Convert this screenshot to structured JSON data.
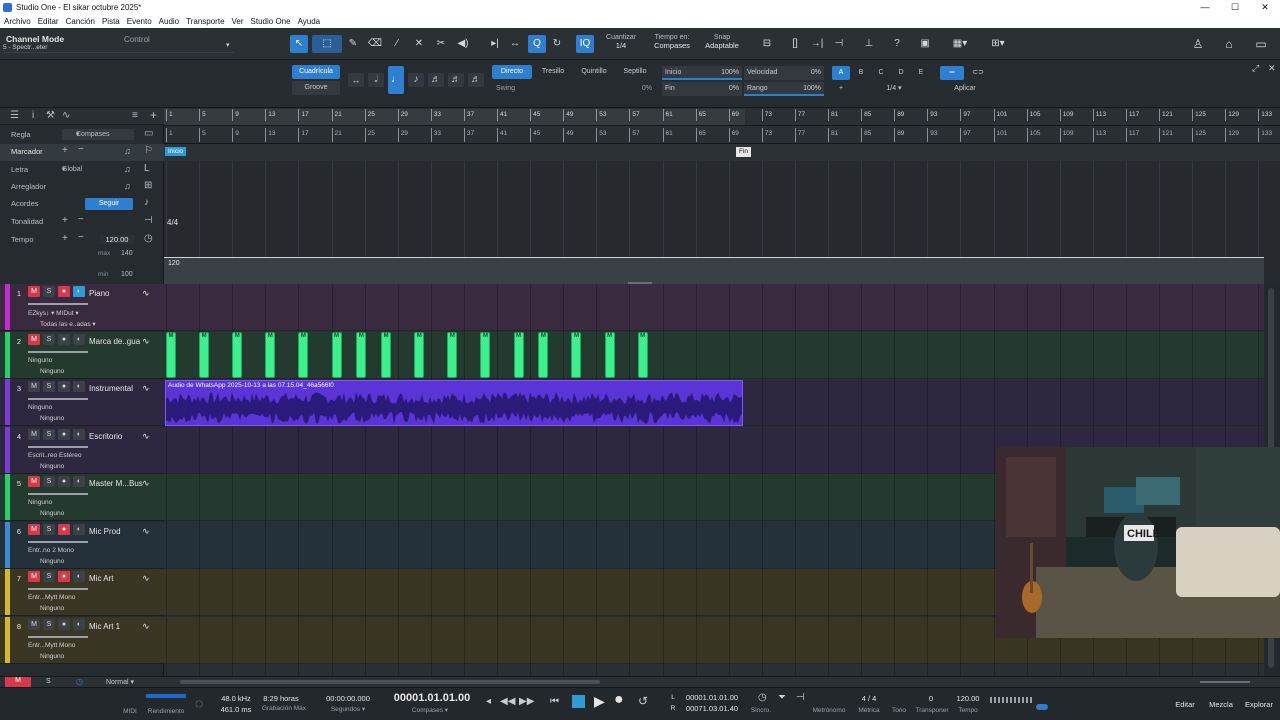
{
  "window": {
    "title": "Studio One - El sikar octubre 2025*",
    "controls": [
      "—",
      "☐",
      "✕"
    ]
  },
  "menu": [
    "Archivo",
    "Editar",
    "Canción",
    "Pista",
    "Evento",
    "Audio",
    "Transporte",
    "Ver",
    "Studio One",
    "Ayuda"
  ],
  "toolbar": {
    "channel_mode": "Channel Mode",
    "channel_sub": "5 - Spectr...eter",
    "control_label": "Control",
    "cuantizar_label": "Cuantizar",
    "cuantizar_value": "1/4",
    "tiempo_label": "Tiempo en:",
    "tiempo_value": "Compases",
    "snap_label": "Snap",
    "snap_value": "Adaptable"
  },
  "quantize": {
    "cuadricula": "Cuadrícula",
    "groove": "Groove",
    "directo": "Directo",
    "tresillo": "Tresillo",
    "quintillo": "Quintillo",
    "septillo": "Septillo",
    "inicio_label": "Inicio",
    "inicio_value": "100%",
    "velocidad_label": "Velocidad",
    "velocidad_value": "0%",
    "swing_label": "Swing",
    "swing_value": "0%",
    "fin_label": "Fin",
    "fin_value": "0%",
    "rango_label": "Rango",
    "rango_value": "100%",
    "letters": [
      "A",
      "B",
      "C",
      "D",
      "E"
    ],
    "plus": "+",
    "fraction": "1/4",
    "aplicar": "Aplicar"
  },
  "global": {
    "regla_label": "Regla",
    "regla_value": "Compases",
    "marcador_label": "Marcador",
    "letra_label": "Letra",
    "letra_value": "Global",
    "arreglador_label": "Arreglador",
    "acordes_label": "Acordes",
    "seguir_label": "Seguir",
    "tonalidad_label": "Tonalidad",
    "tempo_label": "Tempo",
    "tempo_value": "120.00",
    "max_label": "max",
    "max_value": "140",
    "min_label": "min",
    "min_value": "100",
    "time_sig": "4/4",
    "tempo_track_value": "120",
    "inicio_marker": "Inicio",
    "fin_marker": "Fin"
  },
  "ruler_numbers": [
    "1",
    "5",
    "9",
    "13",
    "17",
    "21",
    "25",
    "29",
    "33",
    "37",
    "41",
    "45",
    "49",
    "53",
    "57",
    "61",
    "65",
    "69",
    "73",
    "77",
    "81",
    "85",
    "89",
    "93",
    "97",
    "101",
    "105",
    "109",
    "113",
    "117",
    "121",
    "125",
    "129",
    "133"
  ],
  "tracks": [
    {
      "num": "1",
      "name": "Piano",
      "sub1": "EZkys↕ ▾    MIDut ▾",
      "sub2": "Todas las e..adas ▾",
      "color": "#c42ad0",
      "lane": "#3a2a40",
      "rec": true,
      "mon": true
    },
    {
      "num": "2",
      "name": "Marca de..gua",
      "sub1": "Ninguno",
      "sub2": "Ninguno",
      "color": "#2ad06a",
      "lane": "#243a2e",
      "rec": false,
      "mon": false
    },
    {
      "num": "3",
      "name": "Instrumental",
      "sub1": "Ninguno",
      "sub2": "Ninguno",
      "color": "#7a3ad6",
      "lane": "#2d2840",
      "rec": false,
      "mon": false
    },
    {
      "num": "4",
      "name": "Escritorio",
      "sub1": "Escrit..reo  Estéreo",
      "sub2": "Ninguno",
      "color": "#7a3ad6",
      "lane": "#2d2840",
      "rec": false,
      "mon": false
    },
    {
      "num": "5",
      "name": "Master M...Bus",
      "sub1": "Ninguno",
      "sub2": "Ninguno",
      "color": "#2ad06a",
      "lane": "#243a2e",
      "rec": false,
      "mon": false
    },
    {
      "num": "6",
      "name": "Mic Prod",
      "sub1": "Entr..no 2  Mono",
      "sub2": "Ninguno",
      "color": "#3a8ad6",
      "lane": "#24303a",
      "rec": true,
      "mon": false
    },
    {
      "num": "7",
      "name": "Mic Art",
      "sub1": "Entr...Mytt  Mono",
      "sub2": "Ninguno",
      "color": "#d6b82a",
      "lane": "#3a3624",
      "rec": true,
      "mon": false
    },
    {
      "num": "8",
      "name": "Mic Art 1",
      "sub1": "Entr...Mytt  Mono",
      "sub2": "Ninguno",
      "color": "#d6b82a",
      "lane": "#3a3624",
      "rec": false,
      "mon": false
    }
  ],
  "audio_clip": {
    "label": "Audio de WhatsApp 2025-10-13 a las 07.15.04_46a566f0"
  },
  "midi_clip_letter": "M",
  "bottom_strip": {
    "m": "M",
    "s": "S",
    "normal": "Normal"
  },
  "transport": {
    "midi": "MIDI",
    "rendimiento": "Rendimiento",
    "khz": "48.0 kHz",
    "ms": "461.0 ms",
    "horas": "8:29 horas",
    "grabacion": "Grabación Máx",
    "time": "00:00:00.000",
    "segundos": "Segundos ▾",
    "bars": "00001.01.01.00",
    "compases": "Compases ▾",
    "loop_l": "00001.01.01.00",
    "loop_r": "00071.03.01.40",
    "L": "L",
    "R": "R",
    "sincro": "Sincro.",
    "metronomo": "Metrónomo",
    "metrica_val": "4 / 4",
    "metrica": "Métrica",
    "tono": "Tono",
    "transponer_val": "0",
    "transponer": "Transponer",
    "tempo_val": "120.00",
    "tempo": "Tempo",
    "editar": "Editar",
    "mezcla": "Mezcla",
    "explorar": "Explorar"
  },
  "colors": {
    "accent": "#2e7fd0",
    "midi_green": "#3cf08e",
    "audio_purple": "#5a34d6",
    "record_red": "#d8384a"
  }
}
